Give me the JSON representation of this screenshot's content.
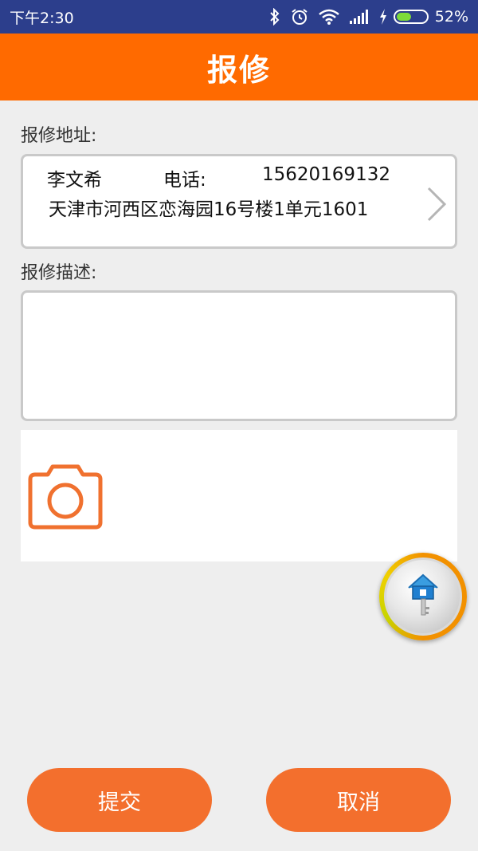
{
  "status_bar": {
    "time": "下午2:30",
    "battery_percent": "52%",
    "battery_level": 0.52,
    "icons": [
      "bluetooth-icon",
      "alarm-icon",
      "wifi-icon",
      "signal-icon",
      "charging-icon",
      "battery-icon"
    ]
  },
  "app_bar": {
    "title": "报修"
  },
  "form": {
    "address_label": "报修地址:",
    "contact_name": "李文希",
    "phone_label": "电话:",
    "phone_number": "15620169132",
    "address_text": "天津市河西区恋海园16号楼1单元1601",
    "description_label": "报修描述:",
    "description_value": ""
  },
  "photo": {
    "icon": "camera-icon"
  },
  "actions": {
    "submit_label": "提交",
    "cancel_label": "取消"
  },
  "colors": {
    "status_bar": "#2c3e8c",
    "app_bar": "#ff6a00",
    "button": "#f36f2d",
    "background": "#eeeeee"
  }
}
